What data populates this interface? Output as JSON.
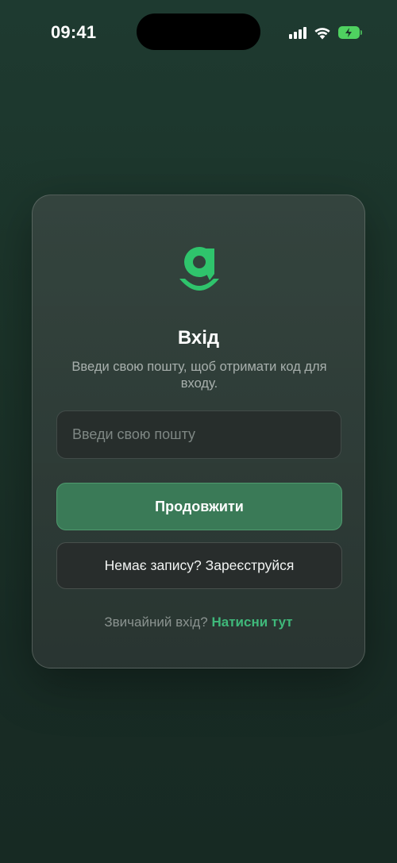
{
  "status_bar": {
    "time": "09:41",
    "icons": [
      "cellular-signal-icon",
      "wifi-icon",
      "battery-charging-icon"
    ],
    "battery_color": "#4fd160"
  },
  "login_card": {
    "logo": "brand-g-logo",
    "title": "Вхід",
    "subtitle": "Введи свою пошту, щоб отримати код для входу.",
    "email": {
      "value": "",
      "placeholder": "Введи свою пошту"
    },
    "continue_label": "Продовжити",
    "register_label": "Немає запису? Зареєструйся",
    "footer_text": "Звичайний вхід?",
    "footer_link": "Натисни тут"
  },
  "colors": {
    "accent": "#3fb87a",
    "primary_button": "#3a7a57",
    "background": "#1b3329"
  }
}
